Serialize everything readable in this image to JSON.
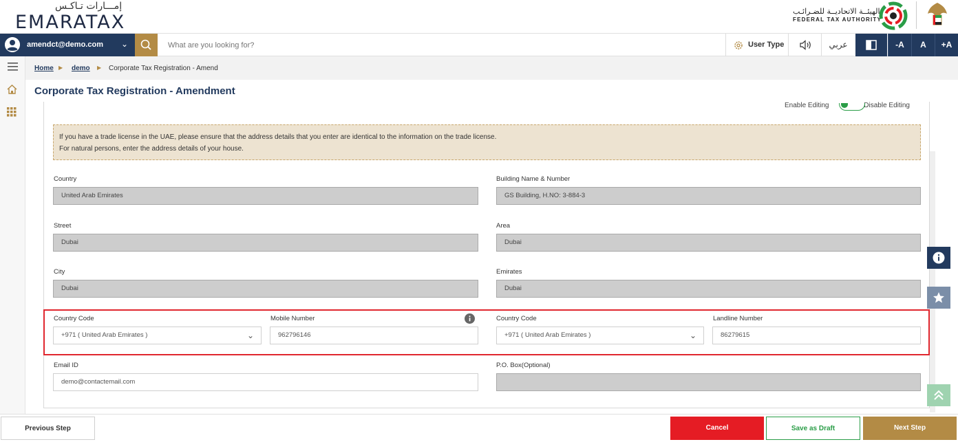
{
  "brand": {
    "logo_ar": "إمـــارات تـاكـس",
    "logo_en": "EMARATAX",
    "fta_ar": "الهيئــة الاتحاديــة للضـرائـب",
    "fta_en": "FEDERAL TAX AUTHORITY"
  },
  "nav": {
    "user_email": "amendct@demo.com",
    "search_placeholder": "What are you looking for?",
    "user_type": "User Type",
    "language": "عربي",
    "font_decrease": "-A",
    "font_normal": "A",
    "font_increase": "+A"
  },
  "breadcrumb": {
    "home": "Home",
    "demo": "demo",
    "current": "Corporate Tax Registration - Amend"
  },
  "page": {
    "title": "Corporate Tax Registration - Amendment",
    "enable_editing": "Enable Editing",
    "disable_editing": "Disable Editing",
    "notice_line1": "If you have a trade license in the UAE, please ensure that the address details that you enter are identical to the information on the trade license.",
    "notice_line2": "For natural persons, enter the address details of your house."
  },
  "form": {
    "country": {
      "label": "Country",
      "value": "United Arab Emirates"
    },
    "building": {
      "label": "Building Name & Number",
      "value": "GS Building, H.NO: 3-884-3"
    },
    "street": {
      "label": "Street",
      "value": "Dubai"
    },
    "area": {
      "label": "Area",
      "value": "Dubai"
    },
    "city": {
      "label": "City",
      "value": "Dubai"
    },
    "emirates": {
      "label": "Emirates",
      "value": "Dubai"
    },
    "mobile_country_code": {
      "label": "Country Code",
      "value": "+971 ( United Arab Emirates )"
    },
    "mobile_number": {
      "label": "Mobile Number",
      "value": "962796146"
    },
    "landline_country_code": {
      "label": "Country Code",
      "value": "+971 ( United Arab Emirates )"
    },
    "landline_number": {
      "label": "Landline Number",
      "value": "86279615"
    },
    "email": {
      "label": "Email ID",
      "value": "demo@contactemail.com"
    },
    "po_box": {
      "label": "P.O. Box(Optional)",
      "value": ""
    }
  },
  "footer": {
    "previous": "Previous Step",
    "cancel": "Cancel",
    "save_draft": "Save as Draft",
    "next": "Next Step"
  },
  "colors": {
    "navy": "#223a5e",
    "gold": "#b38b45",
    "cancel_red": "#e51c24",
    "draft_green": "#2a9d47",
    "highlight_red": "#e0262e"
  }
}
